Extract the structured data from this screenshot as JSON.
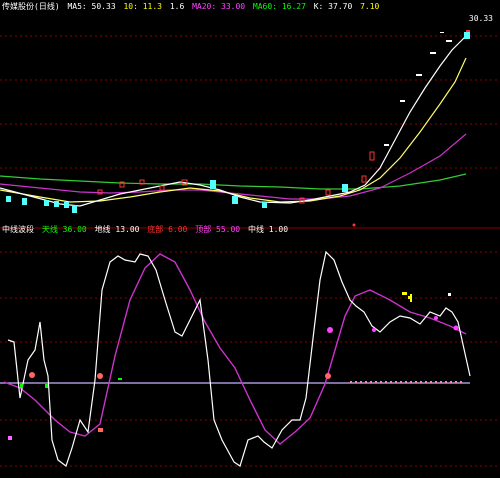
{
  "top_panel": {
    "title": "传媒股份(日线)",
    "indicators": [
      {
        "text": "MA5: 50.33",
        "color": "#ffffff"
      },
      {
        "text": "10: 11.3",
        "color": "#ffff00"
      },
      {
        "text": "1.6",
        "color": "#ffffff"
      },
      {
        "text": "MA20: 33.00",
        "color": "#ff44ff"
      },
      {
        "text": "MA60: 16.27",
        "color": "#00ff00"
      },
      {
        "text": "K: 37.70",
        "color": "#ffffff"
      },
      {
        "text": "7.10",
        "color": "#ffff00"
      }
    ],
    "price_label": "30.33"
  },
  "bottom_panel": {
    "title": "中线波段",
    "indicators": [
      {
        "text": "天线 36.00",
        "color": "#00ff00"
      },
      {
        "text": "地线 13.00",
        "color": "#ffffff"
      },
      {
        "text": "底部 6.00",
        "color": "#ff3333"
      },
      {
        "text": "顶部 55.00",
        "color": "#ff44ff"
      },
      {
        "text": "中线 1.00",
        "color": "#ffffff"
      }
    ]
  },
  "colors": {
    "background": "#000000",
    "up_candle": "#ff3333",
    "down_candle": "#54ffff",
    "grid": "#8b0000",
    "ma_white": "#ffffff",
    "ma_yellow": "#ffff66",
    "ma_magenta": "#cc33cc",
    "ma_green": "#33cc33",
    "separator": "#8b0000",
    "baseline": "#c8b4ff"
  }
}
